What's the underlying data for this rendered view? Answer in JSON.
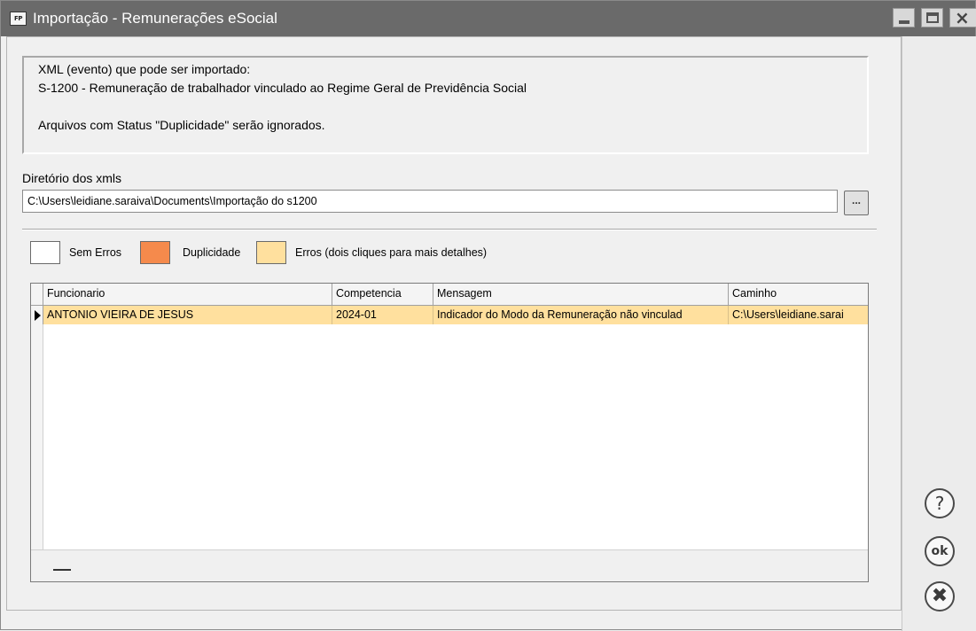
{
  "window": {
    "app_icon_text": "FP",
    "title": "Importação - Remunerações eSocial"
  },
  "info": {
    "line1": "XML (evento) que pode ser importado:",
    "line2": "S-1200 - Remuneração de trabalhador vinculado ao Regime Geral de Previdência Social",
    "line3": "Arquivos com Status \"Duplicidade\" serão ignorados."
  },
  "directory": {
    "label": "Diretório dos xmls",
    "value": "C:\\Users\\leidiane.saraiva\\Documents\\Importação do s1200",
    "browse_label": "..."
  },
  "legend": {
    "no_errors": {
      "label": "Sem Erros",
      "color": "#ffffff"
    },
    "duplicate": {
      "label": "Duplicidade",
      "color": "#f58a4c"
    },
    "errors": {
      "label": "Erros (dois cliques para mais detalhes)",
      "color": "#ffe09e"
    }
  },
  "grid": {
    "columns": [
      "Funcionario",
      "Competencia",
      "Mensagem",
      "Caminho"
    ],
    "rows": [
      {
        "funcionario": "ANTONIO VIEIRA DE JESUS",
        "competencia": "2024-01",
        "mensagem": "Indicador do Modo da Remuneração não vinculad",
        "caminho": "C:\\Users\\leidiane.sarai"
      }
    ]
  },
  "side_buttons": {
    "help": "?",
    "ok": "ok",
    "cancel": "✖"
  }
}
